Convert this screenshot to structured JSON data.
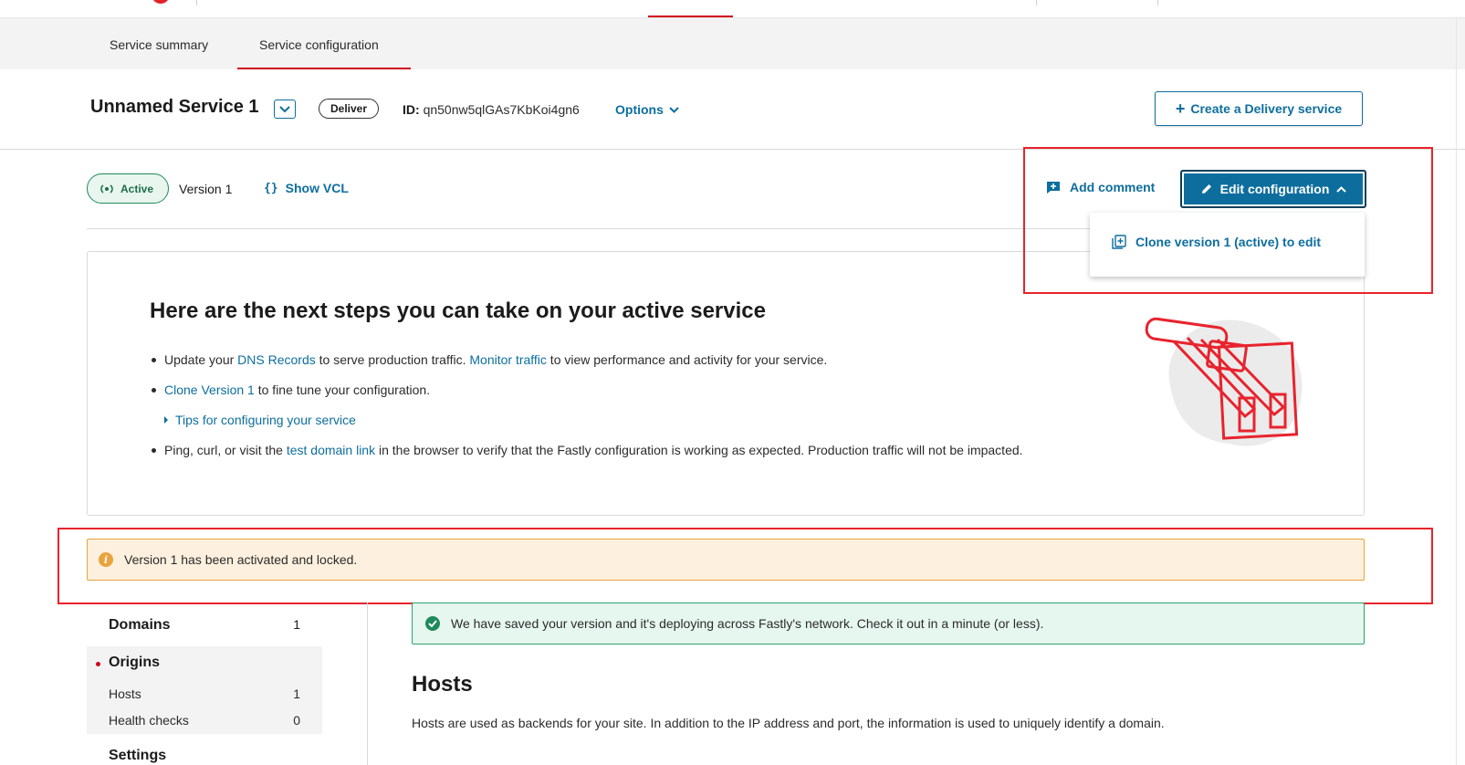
{
  "tabs": [
    {
      "label": "Service summary"
    },
    {
      "label": "Service configuration"
    }
  ],
  "service": {
    "name": "Unnamed Service 1",
    "badge": "Deliver",
    "id_label": "ID:",
    "id_value": "qn50nw5qlGAs7KbKoi4gn6",
    "options_label": "Options",
    "create_button": "Create a Delivery service"
  },
  "version_bar": {
    "status": "Active",
    "version": "Version 1",
    "show_vcl": "Show VCL",
    "add_comment": "Add comment",
    "edit_configuration": "Edit configuration",
    "dropdown_item": "Clone version 1 (active) to edit"
  },
  "next_steps": {
    "title": "Here are the next steps you can take on your active service",
    "step1": {
      "pre": "Update your ",
      "link1": "DNS Records",
      "mid": " to serve production traffic. ",
      "link2": "Monitor traffic",
      "post": " to view performance and activity for your service."
    },
    "step2": {
      "link": "Clone Version 1",
      "post": " to fine tune your configuration."
    },
    "tips": "Tips for configuring your service",
    "step3": {
      "pre": "Ping, curl, or visit the ",
      "link": "test domain link",
      "post": " in the browser to verify that the Fastly configuration is working as expected. Production traffic will not be impacted."
    }
  },
  "warning": {
    "text": "Version 1 has been activated and locked."
  },
  "sidebar": {
    "domains": {
      "label": "Domains",
      "count": "1"
    },
    "origins": {
      "label": "Origins"
    },
    "hosts": {
      "label": "Hosts",
      "count": "1"
    },
    "health_checks": {
      "label": "Health checks",
      "count": "0"
    },
    "settings": {
      "label": "Settings"
    }
  },
  "success": {
    "text": "We have saved your version and it's deploying across Fastly's network. Check it out in a minute (or less)."
  },
  "hosts": {
    "title": "Hosts",
    "description": "Hosts are used as backends for your site. In addition to the IP address and port, the information is used to uniquely identify a domain."
  },
  "colors": {
    "accent": "#0d6e9e",
    "brand_red": "#d0021b",
    "success": "#1f8a5c",
    "warning": "#e8a33d",
    "annotation": "#e8232d"
  }
}
